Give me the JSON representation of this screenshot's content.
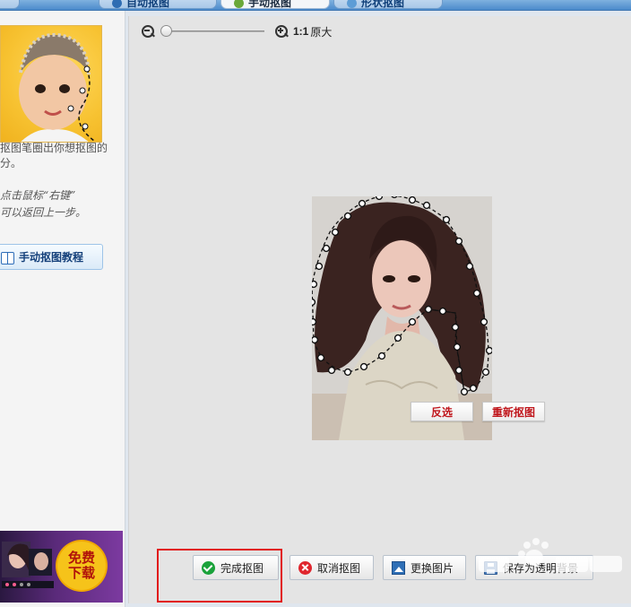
{
  "tabs": {
    "auto": "自动抠图",
    "manual": "手动抠图",
    "shape": "形状抠图"
  },
  "left_panel": {
    "hint": "抠图笔圈出你想抠图的",
    "hint_tail": "分。",
    "tip_line1": "点击鼠标“右键”",
    "tip_line2": "可以返回上一步。",
    "tutorial_button": "手动抠图教程",
    "ad": {
      "line1": "免费",
      "line2": "下载"
    }
  },
  "zoom": {
    "ratio": "1:1",
    "label": "原大",
    "level": 0.0
  },
  "photo_actions": {
    "invert": "反选",
    "reset": "重新抠图"
  },
  "bottom_actions": {
    "done": "完成抠图",
    "cancel": "取消抠图",
    "replace": "更换图片",
    "save": "保存为透明背景"
  },
  "colors": {
    "highlight": "#e11a1a",
    "action_text": "#c0161c",
    "done_icon": "#1aa23a",
    "cancel_icon": "#e0262e"
  }
}
